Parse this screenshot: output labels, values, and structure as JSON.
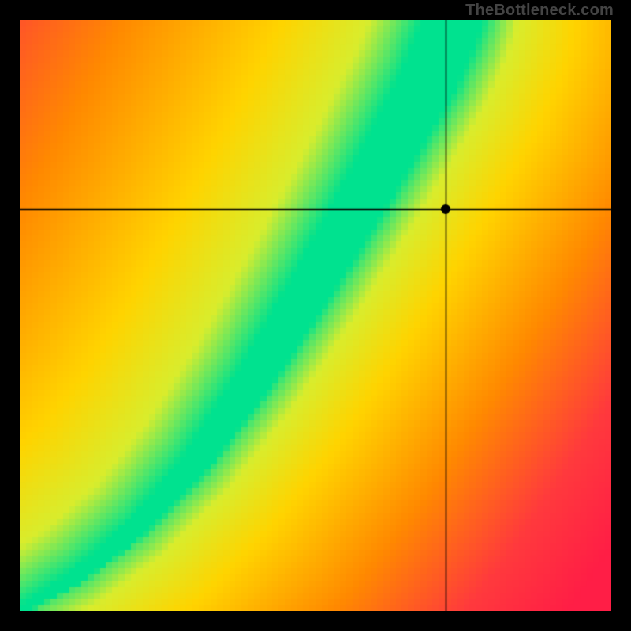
{
  "watermark": "TheBottleneck.com",
  "chart_data": {
    "type": "heatmap",
    "title": "",
    "xlabel": "",
    "ylabel": "",
    "xlim": [
      0,
      1
    ],
    "ylim": [
      0,
      1
    ],
    "crosshair": {
      "x": 0.72,
      "y": 0.68
    },
    "resolution": 96,
    "description": "Heatmap where color encodes distance from an optimal curved ridge. Green = on ridge (best), yellow = near, orange/red = far. The ridge is a monotonically increasing curve from bottom-left toward top-right, steeper in the middle, ending near the top edge around x≈0.73. Points above-left and below-right of the ridge fall to red. The ridge band is narrow at the bottom and widens slightly toward the top.",
    "ridge_points": [
      {
        "x": 0.0,
        "y": 0.0
      },
      {
        "x": 0.1,
        "y": 0.06
      },
      {
        "x": 0.2,
        "y": 0.14
      },
      {
        "x": 0.3,
        "y": 0.25
      },
      {
        "x": 0.4,
        "y": 0.39
      },
      {
        "x": 0.5,
        "y": 0.55
      },
      {
        "x": 0.6,
        "y": 0.72
      },
      {
        "x": 0.65,
        "y": 0.81
      },
      {
        "x": 0.7,
        "y": 0.9
      },
      {
        "x": 0.73,
        "y": 0.97
      },
      {
        "x": 0.74,
        "y": 1.0
      }
    ],
    "ridge_halfwidth": [
      {
        "r": 0.0,
        "w": 0.01
      },
      {
        "r": 0.3,
        "w": 0.022
      },
      {
        "r": 0.6,
        "w": 0.04
      },
      {
        "r": 1.0,
        "w": 0.06
      }
    ],
    "color_stops": [
      {
        "t": 0.0,
        "color": "#00e28f"
      },
      {
        "t": 0.07,
        "color": "#00e28f"
      },
      {
        "t": 0.16,
        "color": "#d9ed2d"
      },
      {
        "t": 0.3,
        "color": "#ffd400"
      },
      {
        "t": 0.55,
        "color": "#ff8a00"
      },
      {
        "t": 0.8,
        "color": "#ff3a3d"
      },
      {
        "t": 1.0,
        "color": "#ff1e46"
      }
    ]
  }
}
